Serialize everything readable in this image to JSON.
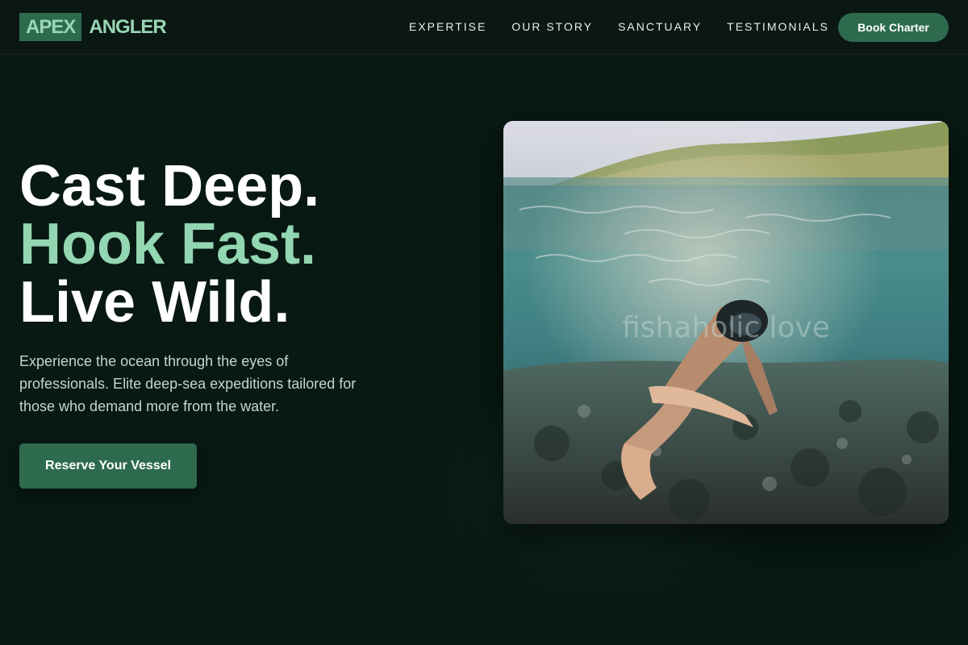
{
  "brand": {
    "box": "APEX",
    "word": "ANGLER"
  },
  "nav": {
    "links": [
      "EXPERTISE",
      "OUR STORY",
      "SANCTUARY",
      "TESTIMONIALS"
    ],
    "cta": "Book Charter"
  },
  "hero": {
    "line1": "Cast Deep.",
    "line2": "Hook Fast.",
    "line3": "Live Wild.",
    "subtitle": "Experience the ocean through the eyes of professionals. Elite deep-sea expeditions tailored for those who demand more from the water.",
    "cta": "Reserve Your Vessel"
  },
  "image": {
    "subject": "snorkeler underwater reaching toward camera",
    "watermark": "fishaholic love"
  },
  "colors": {
    "background": "#081812",
    "accent": "#2e6b4e",
    "highlight": "#93d6b2"
  }
}
